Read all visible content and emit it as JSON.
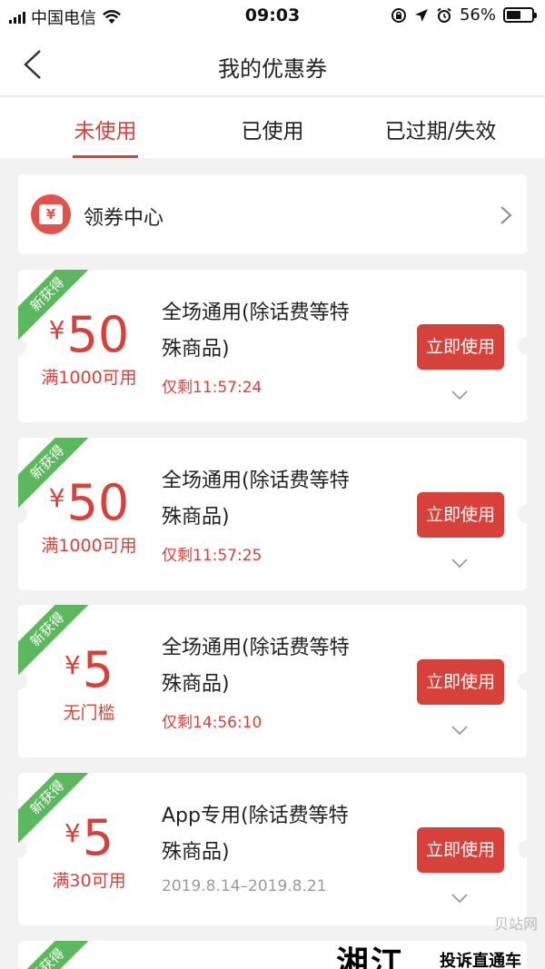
{
  "status_bar": {
    "carrier": "中国电信",
    "time": "09:03",
    "battery_percent": "56%",
    "battery_level": 0.56,
    "icons": [
      "signal-icon",
      "wifi-icon",
      "rotation-lock-icon",
      "location-icon",
      "alarm-icon",
      "battery-icon"
    ]
  },
  "nav": {
    "title": "我的优惠券",
    "back_icon": "chevron-left-icon"
  },
  "tabs": [
    {
      "label": "未使用",
      "active": true
    },
    {
      "label": "已使用",
      "active": false
    },
    {
      "label": "已过期/失效",
      "active": false
    }
  ],
  "coupon_center": {
    "label": "领券中心",
    "icon_glyph": "¥",
    "icon": "coupon-icon",
    "arrow_icon": "chevron-right-icon"
  },
  "coupons": [
    {
      "ribbon": "新获得",
      "currency": "¥",
      "amount": "50",
      "condition": "满1000可用",
      "line1": "全场通用(除话费等特",
      "line2": "殊商品)",
      "time": "仅剩11:57:24",
      "time_style": "red",
      "button": "立即使用"
    },
    {
      "ribbon": "新获得",
      "currency": "¥",
      "amount": "50",
      "condition": "满1000可用",
      "line1": "全场通用(除话费等特",
      "line2": "殊商品)",
      "time": "仅剩11:57:25",
      "time_style": "red",
      "button": "立即使用"
    },
    {
      "ribbon": "新获得",
      "currency": "¥",
      "amount": "5",
      "condition": "无门槛",
      "line1": "全场通用(除话费等特",
      "line2": "殊商品)",
      "time": "仅剩14:56:10",
      "time_style": "red",
      "button": "立即使用"
    },
    {
      "ribbon": "新获得",
      "currency": "¥",
      "amount": "5",
      "condition": "满30可用",
      "line1": "App专用(除话费等特",
      "line2": "殊商品)",
      "time": "2019.8.14–2019.8.21",
      "time_style": "grey",
      "button": "立即使用"
    }
  ],
  "partial_coupon": {
    "ribbon": "新获得"
  },
  "watermark": {
    "big": "湘江",
    "small": "投诉直通车",
    "corner": "贝站网"
  },
  "colors": {
    "accent": "#d8403a",
    "ribbon": "#5cb85c",
    "background": "#f2f2f2"
  }
}
